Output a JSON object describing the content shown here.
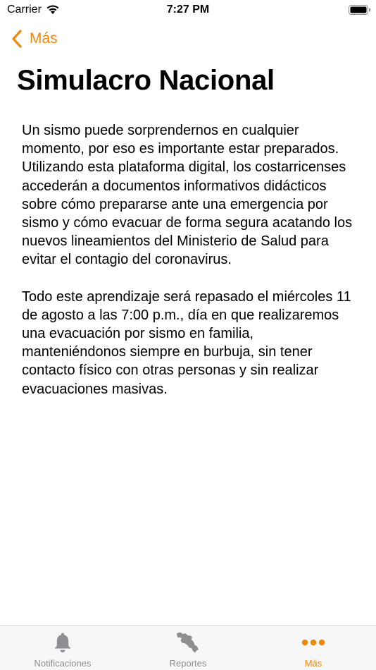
{
  "status_bar": {
    "carrier": "Carrier",
    "time": "7:27 PM",
    "icons": [
      "wifi-icon",
      "battery-icon"
    ]
  },
  "nav": {
    "back_label": "Más",
    "back_icon": "chevron-left-icon"
  },
  "page": {
    "title": "Simulacro Nacional",
    "paragraphs": [
      "Un sismo puede sorprendernos en cualquier momento, por eso es importante estar preparados. Utilizando esta plataforma digital, los costarricenses accederán a documentos informativos didácticos sobre cómo prepararse ante una emergencia por sismo y cómo evacuar de forma segura acatando los nuevos lineamientos del Ministerio de Salud para evitar el contagio del coronavirus.",
      "Todo este aprendizaje será repasado el miércoles 11 de agosto a las 7:00 p.m., día en que realizaremos una evacuación por sismo en familia, manteniéndonos siempre en burbuja, sin tener contacto físico con otras personas y sin realizar evacuaciones masivas."
    ]
  },
  "tab_bar": {
    "tabs": [
      {
        "label": "Notificaciones",
        "icon": "bell-icon",
        "active": false
      },
      {
        "label": "Reportes",
        "icon": "costa-rica-map-icon",
        "active": false
      },
      {
        "label": "Más",
        "icon": "more-dots-icon",
        "active": true
      }
    ]
  },
  "colors": {
    "accent": "#f0870f",
    "inactive": "#8e8e93"
  }
}
